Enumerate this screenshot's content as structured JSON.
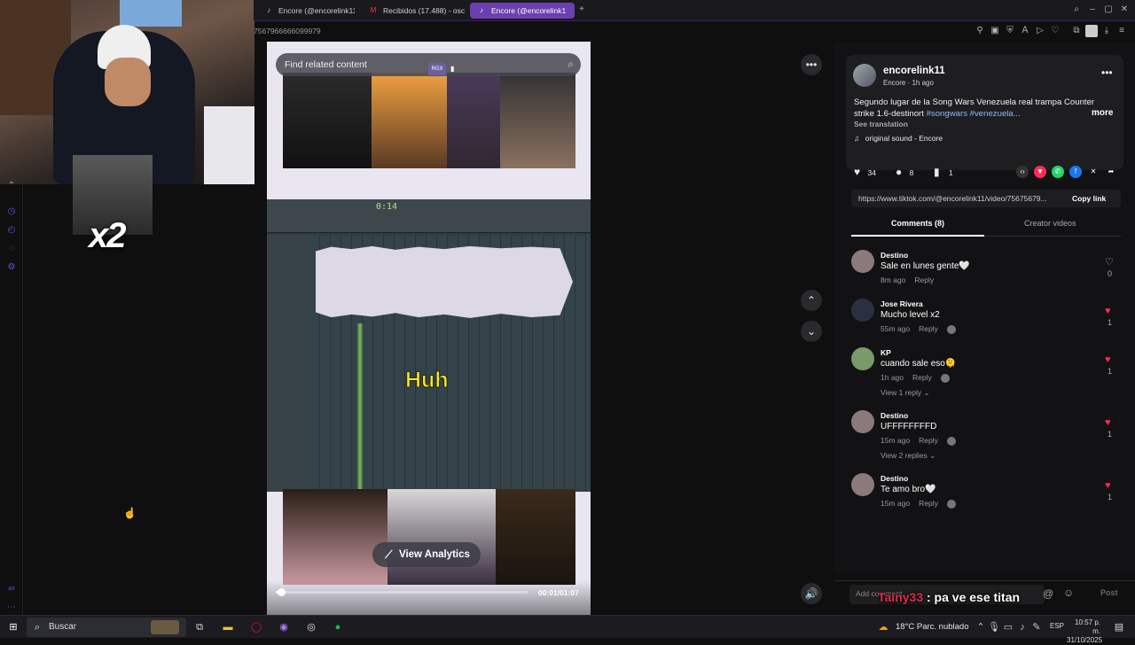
{
  "browser": {
    "tabs": [
      {
        "label": "Encore (@encorelink11)",
        "icon": "tiktok-icon",
        "active": false
      },
      {
        "label": "Recibidos (17.488) - osc",
        "icon": "gmail-icon",
        "active": false
      },
      {
        "label": "Encore (@encorelink1",
        "icon": "tiktok-icon",
        "active": true
      }
    ],
    "new_tab": "+",
    "url_fragment": "7567966666099979"
  },
  "overlay": {
    "x2_label": "x2"
  },
  "video": {
    "search_placeholder": "Find related content",
    "badge": "RGX",
    "daw_time": "0:14",
    "caption": "Huh",
    "analytics_label": "View Analytics",
    "time": "00:01/01:07",
    "progress": 0.015
  },
  "post": {
    "author": "encorelink11",
    "author_sub": "Encore · 1h ago",
    "description": "Segundo lugar de la Song Wars Venezuela real trampa Counter strike 1.6-destinort",
    "hashtags": [
      "#songwars",
      "#venezuela..."
    ],
    "more_label": "more",
    "see_translation": "See translation",
    "sound": "original sound - Encore",
    "likes": "34",
    "comments": "8",
    "saves": "1",
    "link": "https://www.tiktok.com/@encorelink11/video/75675679...",
    "copy_link": "Copy link"
  },
  "panel_tabs": {
    "comments": "Comments (8)",
    "creator": "Creator videos"
  },
  "comments": [
    {
      "user": "Destino",
      "text": "Sale en lunes gente🤍",
      "time": "8m ago",
      "reply": "Reply",
      "likes": "0",
      "liked": false,
      "view": "",
      "has_badge": false
    },
    {
      "user": "Jose Rivera",
      "text": "Mucho level x2",
      "time": "55m ago",
      "reply": "Reply",
      "likes": "1",
      "liked": true,
      "view": "",
      "has_badge": true
    },
    {
      "user": "KP",
      "text": "cuando sale eso🫠",
      "time": "1h ago",
      "reply": "Reply",
      "likes": "1",
      "liked": true,
      "view": "View 1 reply ⌄",
      "has_badge": true
    },
    {
      "user": "Destino",
      "text": "UFFFFFFFFD",
      "time": "15m ago",
      "reply": "Reply",
      "likes": "1",
      "liked": true,
      "view": "View 2 replies ⌄",
      "has_badge": true
    },
    {
      "user": "Destino",
      "text": "Te amo bro🤍",
      "time": "15m ago",
      "reply": "Reply",
      "likes": "1",
      "liked": true,
      "view": "",
      "has_badge": true
    }
  ],
  "comment_bar": {
    "placeholder": "Add comment...",
    "post": "Post"
  },
  "chat": {
    "user": "Tainy33",
    "message": ": pa ve ese titan"
  },
  "taskbar": {
    "search": "Buscar",
    "weather": "18°C  Parc. nublado",
    "lang": "ESP",
    "time": "10:57 p. m.",
    "date": "31/10/2025"
  },
  "colors": {
    "accent": "#6b3fb0",
    "like": "#fe2c55",
    "caption": "#f5e63a",
    "tag": "#8fb8ff"
  }
}
